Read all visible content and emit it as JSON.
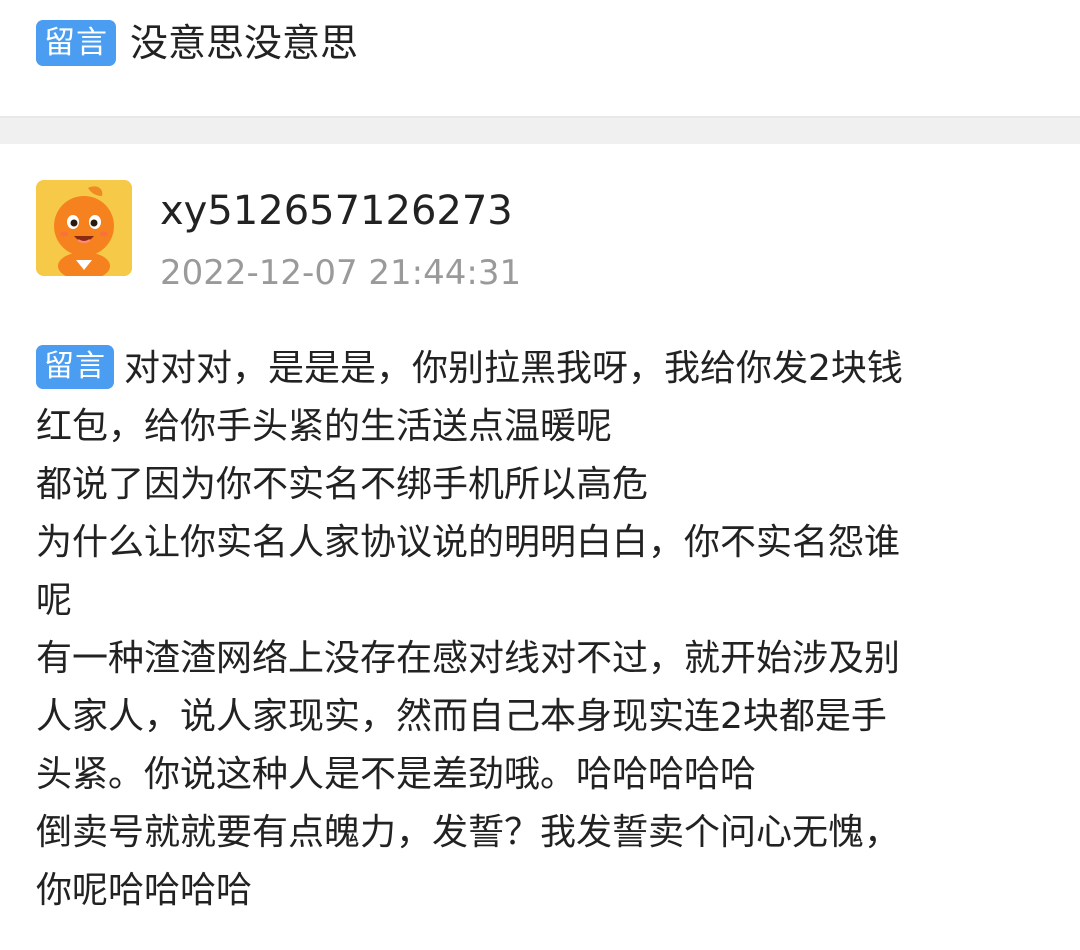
{
  "top": {
    "tag": "留言",
    "text": "没意思没意思"
  },
  "post": {
    "username": "xy512657126273",
    "timestamp": "2022-12-07 21:44:31",
    "tag": "留言",
    "lines": [
      "对对对，是是是，你别拉黑我呀，我给你发2块钱",
      "红包，给你手头紧的生活送点温暖呢",
      "都说了因为你不实名不绑手机所以高危",
      "为什么让你实名人家协议说的明明白白，你不实名怨谁",
      "呢",
      "有一种渣渣网络上没存在感对线对不过，就开始涉及别",
      "人家人，说人家现实，然而自己本身现实连2块都是手",
      "头紧。你说这种人是不是差劲哦。哈哈哈哈哈",
      "倒卖号就就要有点魄力，发誓？我发誓卖个问心无愧，",
      "你呢哈哈哈哈"
    ]
  },
  "colors": {
    "tag_bg": "#4a9df0",
    "timestamp": "#9a9a9a",
    "divider": "#f0f0f0",
    "avatar_bg": "#f7c948"
  },
  "icons": {
    "avatar": "orange-mascot-avatar-icon"
  }
}
